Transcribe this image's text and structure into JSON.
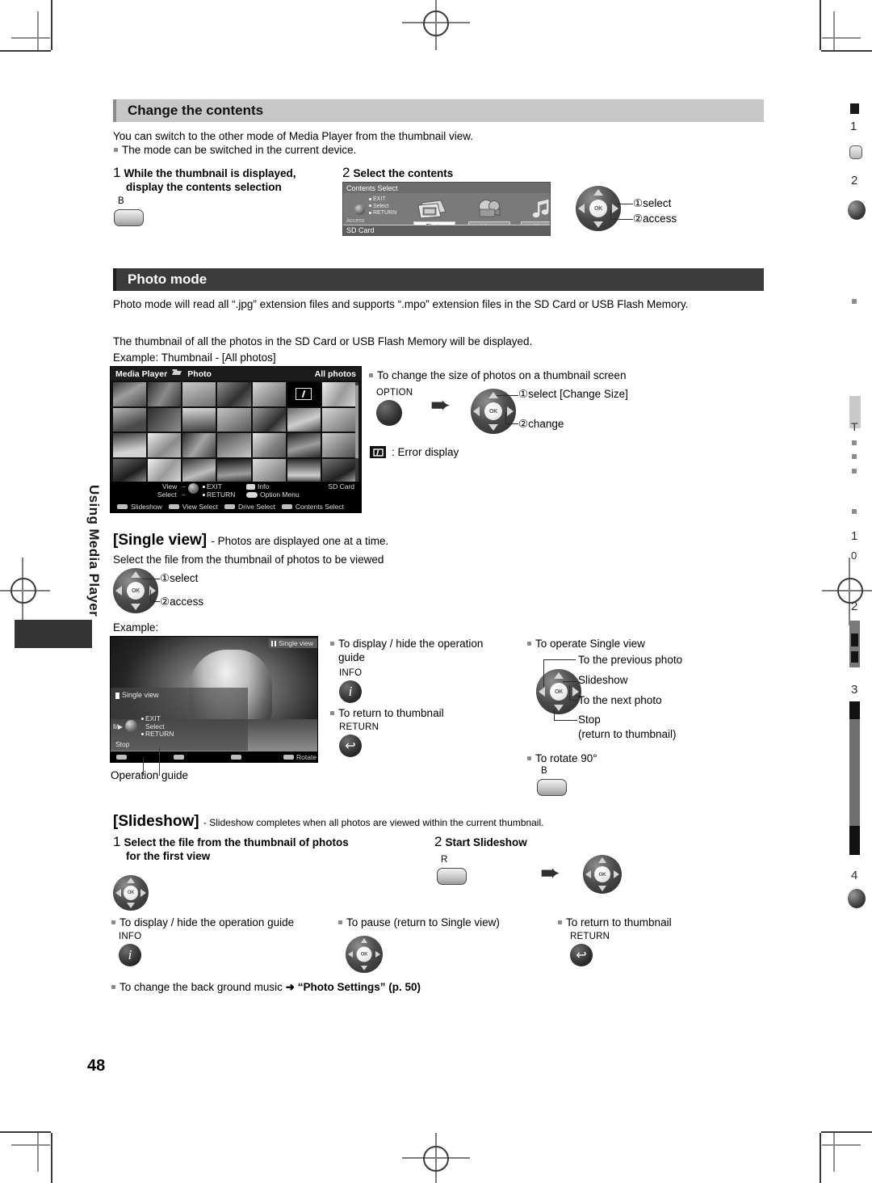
{
  "page": {
    "number": "48",
    "side_tab_label": "Using Media Player"
  },
  "section_change": {
    "heading": "Change the contents",
    "intro": "You can switch to the other mode of Media Player from the thumbnail view.",
    "bullet": "The mode can be switched in the current device.",
    "step1": {
      "num": "1",
      "line1": "While the thumbnail is displayed,",
      "line2": "display the contents selection",
      "button": "B"
    },
    "step2": {
      "num": "2",
      "label": "Select the contents"
    },
    "tv": {
      "title": "Contents Select",
      "guide": [
        "EXIT",
        "Select",
        "RETURN"
      ],
      "access": "Access",
      "footer": "SD Card",
      "items": [
        {
          "label": "Photo",
          "icon": "photos-icon",
          "selected": true
        },
        {
          "label": "Video",
          "icon": "camcorder-icon",
          "selected": false
        },
        {
          "label": "Music",
          "icon": "music-note-icon",
          "selected": false
        }
      ]
    },
    "dpad_labels": {
      "one": "①select",
      "two": "②access"
    }
  },
  "section_photo": {
    "heading": "Photo mode",
    "para1": "Photo mode will read all “.jpg” extension files and supports “.mpo” extension files in the SD Card or USB Flash Memory.",
    "para2": "The thumbnail of all the photos in the SD Card or USB Flash Memory will be displayed.",
    "para3": "Example: Thumbnail - [All photos]",
    "tv": {
      "title_left": "Media Player",
      "title_mid": "Photo",
      "title_right": "All photos",
      "guide": {
        "view": "View",
        "select": "Select",
        "exit": "EXIT",
        "return": "RETURN",
        "info": "Info",
        "option_menu": "Option Menu",
        "device": "SD Card",
        "colors": [
          "Slideshow",
          "View Select",
          "Drive Select",
          "Contents Select"
        ]
      }
    },
    "change_size": {
      "bullet": "To change the size of photos on a thumbnail screen",
      "option_button": "OPTION",
      "one": "①select [Change Size]",
      "two": "②change"
    },
    "error_display": ": Error display"
  },
  "section_single": {
    "heading": "[Single view]",
    "heading_sub": "- Photos are displayed one at a time.",
    "line": "Select the file from the thumbnail of photos to be viewed",
    "dpad_labels": {
      "one": "①select",
      "two": "②access"
    },
    "example": "Example:",
    "tv": {
      "badge": "Single view",
      "op_title": "Single view",
      "pp": "ll/▶",
      "guide": [
        "EXIT",
        "Select",
        "RETURN"
      ],
      "stop": "Stop",
      "rotate": "Rotate"
    },
    "operation_guide_caption": "Operation guide",
    "col_mid": {
      "bullet1_l1": "To display / hide the operation",
      "bullet1_l2": "guide",
      "info_label": "INFO",
      "bullet2": "To return to thumbnail",
      "return_label": "RETURN"
    },
    "col_right": {
      "bullet": "To operate Single view",
      "labels": [
        "To the previous photo",
        "Slideshow",
        "To the next photo",
        "Stop",
        "(return to thumbnail)"
      ],
      "rotate_bullet": "To rotate 90°",
      "rotate_button": "B"
    }
  },
  "section_slideshow": {
    "heading": "[Slideshow]",
    "heading_sub": "- Slideshow completes when all photos are viewed within the current thumbnail.",
    "step1": {
      "num": "1",
      "line1": "Select the file from the thumbnail of photos",
      "line2": "for the first view"
    },
    "step2": {
      "num": "2",
      "label": "Start Slideshow",
      "button": "R"
    },
    "bullets": [
      {
        "text": "To display / hide the operation guide",
        "button": "INFO"
      },
      {
        "text": "To pause (return to Single view)",
        "button": ""
      },
      {
        "text": "To return to thumbnail",
        "button": "RETURN"
      }
    ],
    "bgm": {
      "pre": "To change the back ground music",
      "arrow": "➜",
      "bold": "“Photo Settings” (p. 50)"
    }
  }
}
